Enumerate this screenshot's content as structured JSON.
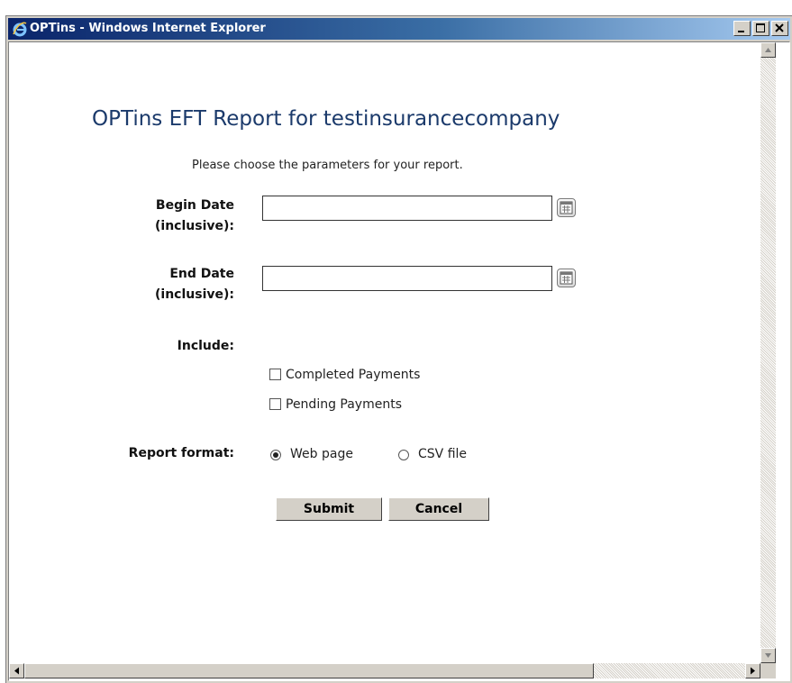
{
  "window": {
    "title": "OPTins - Windows Internet Explorer",
    "controls": [
      "minimize-icon",
      "maximize-icon",
      "close-icon"
    ]
  },
  "page": {
    "title": "OPTins EFT Report for testinsurancecompany",
    "subtitle": "Please choose the parameters for your report."
  },
  "form": {
    "begin_date": {
      "label_line1": "Begin Date",
      "label_line2": "(inclusive):",
      "value": "",
      "icon": "calendar-icon"
    },
    "end_date": {
      "label_line1": "End Date",
      "label_line2": "(inclusive):",
      "value": "",
      "icon": "calendar-icon"
    },
    "include": {
      "label": "Include:",
      "options": [
        {
          "label": "Completed Payments",
          "checked": false
        },
        {
          "label": "Pending Payments",
          "checked": false
        }
      ]
    },
    "report_format": {
      "label": "Report format:",
      "options": [
        {
          "label": "Web page",
          "selected": true
        },
        {
          "label": "CSV file",
          "selected": false
        }
      ]
    },
    "submit_label": "Submit",
    "cancel_label": "Cancel"
  },
  "colors": {
    "title_bar_start": "#0a246a",
    "title_bar_end": "#a6caf0",
    "page_title": "#1b3a6b",
    "chrome": "#d4d0c8"
  }
}
